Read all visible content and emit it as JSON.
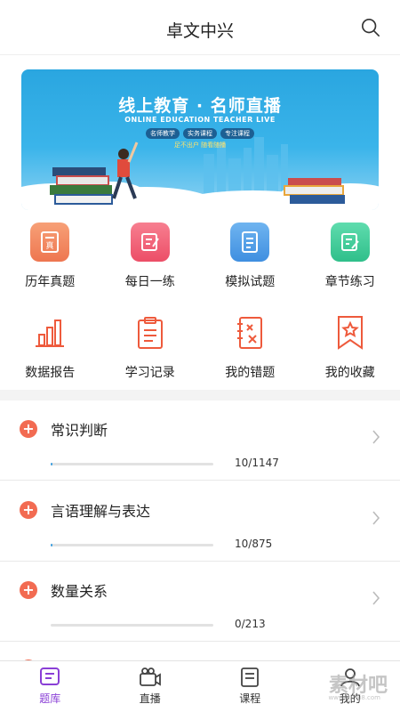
{
  "header": {
    "title": "卓文中兴",
    "search_icon": "search-icon"
  },
  "banner": {
    "title": "线上教育 · 名师直播",
    "subtitle": "ONLINE EDUCATION TEACHER LIVE",
    "tags": [
      "名师教学",
      "实务课程",
      "专注课程"
    ],
    "note": "足不出户 随看随播"
  },
  "grid_top": [
    {
      "label": "历年真题",
      "icon": "past-exam-icon",
      "color": "#f38b62"
    },
    {
      "label": "每日一练",
      "icon": "daily-practice-icon",
      "color": "#f2657a"
    },
    {
      "label": "模拟试题",
      "icon": "mock-exam-icon",
      "color": "#4f9fe6"
    },
    {
      "label": "章节练习",
      "icon": "chapter-practice-icon",
      "color": "#3fcb9a"
    }
  ],
  "grid_bottom": [
    {
      "label": "数据报告",
      "icon": "bar-chart-icon"
    },
    {
      "label": "学习记录",
      "icon": "clipboard-icon"
    },
    {
      "label": "我的错题",
      "icon": "wrong-notebook-icon"
    },
    {
      "label": "我的收藏",
      "icon": "star-bookmark-icon"
    }
  ],
  "accent": "#f26b52",
  "categories": [
    {
      "name": "常识判断",
      "count": "10/1147",
      "progress": 0.009
    },
    {
      "name": "言语理解与表达",
      "count": "10/875",
      "progress": 0.011
    },
    {
      "name": "数量关系",
      "count": "0/213",
      "progress": 0.0
    }
  ],
  "tabs": [
    {
      "label": "题库",
      "icon": "question-bank-icon",
      "active": true
    },
    {
      "label": "直播",
      "icon": "live-camera-icon",
      "active": false
    },
    {
      "label": "课程",
      "icon": "course-icon",
      "active": false
    },
    {
      "label": "我的",
      "icon": "profile-icon",
      "active": false
    }
  ],
  "watermark": {
    "text": "素材吧",
    "url": "www.sucai8.com"
  }
}
